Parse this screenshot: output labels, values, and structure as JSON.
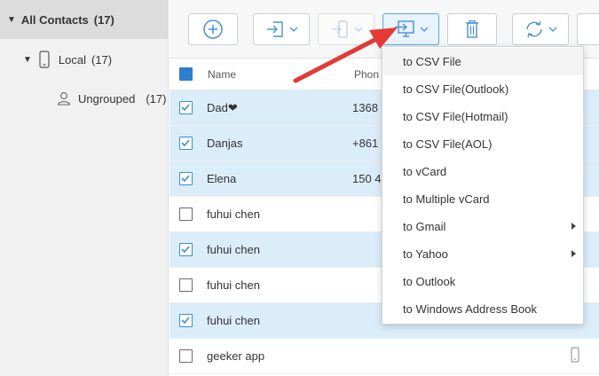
{
  "sidebar": {
    "all_contacts": {
      "label": "All Contacts",
      "count": "(17)"
    },
    "local": {
      "label": "Local",
      "count": "(17)"
    },
    "ungrouped": {
      "label": "Ungrouped",
      "count": "(17)"
    }
  },
  "toolbar": {
    "buttons": [
      {
        "name": "add-contact-button",
        "icon": "plus-circle-icon"
      },
      {
        "name": "import-button",
        "icon": "import-icon",
        "has_dropdown": true
      },
      {
        "name": "export-to-device-button",
        "icon": "phone-export-icon",
        "has_dropdown": true
      },
      {
        "name": "export-to-computer-button",
        "icon": "monitor-export-icon",
        "has_dropdown": true,
        "active": true
      },
      {
        "name": "delete-button",
        "icon": "trash-icon"
      },
      {
        "name": "refresh-button",
        "icon": "refresh-icon",
        "has_dropdown": true
      }
    ]
  },
  "table": {
    "columns": [
      "Name",
      "Phon"
    ],
    "rows": [
      {
        "name": "Dad❤",
        "phone": "1368",
        "checked": true
      },
      {
        "name": "Danjas",
        "phone": "+861",
        "checked": true
      },
      {
        "name": "Elena",
        "phone": "150 4",
        "checked": true
      },
      {
        "name": "fuhui chen",
        "phone": "",
        "checked": false
      },
      {
        "name": "fuhui chen",
        "phone": "",
        "checked": true
      },
      {
        "name": "fuhui chen",
        "phone": "",
        "checked": false
      },
      {
        "name": "fuhui chen",
        "phone": "",
        "checked": true
      },
      {
        "name": "geeker app",
        "phone": "",
        "checked": false
      }
    ]
  },
  "export_menu": {
    "items": [
      {
        "label": "to CSV File",
        "submenu": false
      },
      {
        "label": "to CSV File(Outlook)",
        "submenu": false
      },
      {
        "label": "to CSV File(Hotmail)",
        "submenu": false
      },
      {
        "label": "to CSV File(AOL)",
        "submenu": false
      },
      {
        "label": "to vCard",
        "submenu": false
      },
      {
        "label": "to Multiple vCard",
        "submenu": false
      },
      {
        "label": "to Gmail",
        "submenu": true
      },
      {
        "label": "to Yahoo",
        "submenu": true
      },
      {
        "label": "to Outlook",
        "submenu": false
      },
      {
        "label": "to Windows Address Book",
        "submenu": false
      }
    ]
  },
  "colors": {
    "selected_row": "#dcedfa",
    "accent_blue": "#2b7fd0",
    "annotation_arrow": "#e53935"
  }
}
